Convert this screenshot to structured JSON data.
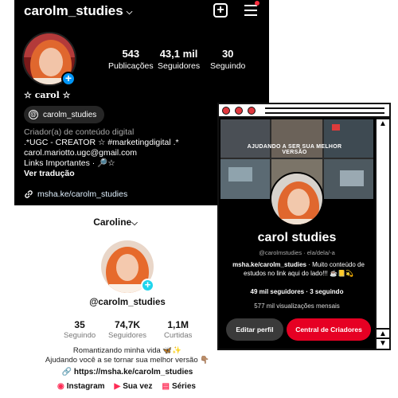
{
  "instagram": {
    "username": "carolm_studies",
    "stats": [
      {
        "value": "543",
        "label": "Publicações"
      },
      {
        "value": "43,1 mil",
        "label": "Seguidores"
      },
      {
        "value": "30",
        "label": "Seguindo"
      }
    ],
    "display_name": "☆ carol ☆",
    "threads_handle": "carolm_studies",
    "bio_category": "Criador(a) de conteúdo digital",
    "bio_lines": [
      ".*UGC - CREATOR ☆ #marketingdigital .*",
      "carol.mariotto.ugc@gmail.com",
      "Links Importantes · 🔎☆"
    ],
    "see_translation": "Ver tradução",
    "link": "msha.ke/carolm_studies",
    "icons": [
      "chevron-down-icon",
      "new-post-icon",
      "menu-icon",
      "add-story-icon",
      "threads-icon",
      "link-icon"
    ],
    "colors": {
      "background": "#000000",
      "accent": "#0095f6",
      "notification": "#ff3040"
    }
  },
  "tiktok": {
    "username": "Caroline",
    "handle": "@carolm_studies",
    "stats": [
      {
        "value": "35",
        "label": "Seguindo"
      },
      {
        "value": "74,7K",
        "label": "Seguidores"
      },
      {
        "value": "1,1M",
        "label": "Curtidas"
      }
    ],
    "bio_lines": [
      "Romantizando minha vida 🦋✨",
      "Ajudando você a se tornar sua melhor versão 👇🏽"
    ],
    "link": "https://msha.ke/carolm_studies",
    "tabs": [
      {
        "icon": "instagram-icon",
        "label": "Instagram"
      },
      {
        "icon": "youtube-icon",
        "label": "Sua vez"
      },
      {
        "icon": "playlist-icon",
        "label": "Séries"
      }
    ],
    "colors": {
      "accent": "#20d5ec",
      "tab_icon": "#fe2c55"
    }
  },
  "pinterest": {
    "cover_text": "AJUDANDO A SER SUA MELHOR VERSÃO",
    "name": "carol studies",
    "subtitle": "@carolmstudies · ela/dela/-a",
    "bio_link": "msha.ke/carolm_studies",
    "bio_rest": " · Muito conteúdo de estudos no link aqui do lado!!! ☕📒💫",
    "followers": "49 mil seguidores · 3 seguindo",
    "views": "577 mil visualizações mensais",
    "edit_button": "Editar perfil",
    "creator_button": "Central de Criadores",
    "icons": [
      "window-close-dot-icon",
      "scroll-up-icon",
      "scroll-down-icon"
    ],
    "colors": {
      "primary_button": "#e60023",
      "window_dot": "#e0383e"
    }
  }
}
